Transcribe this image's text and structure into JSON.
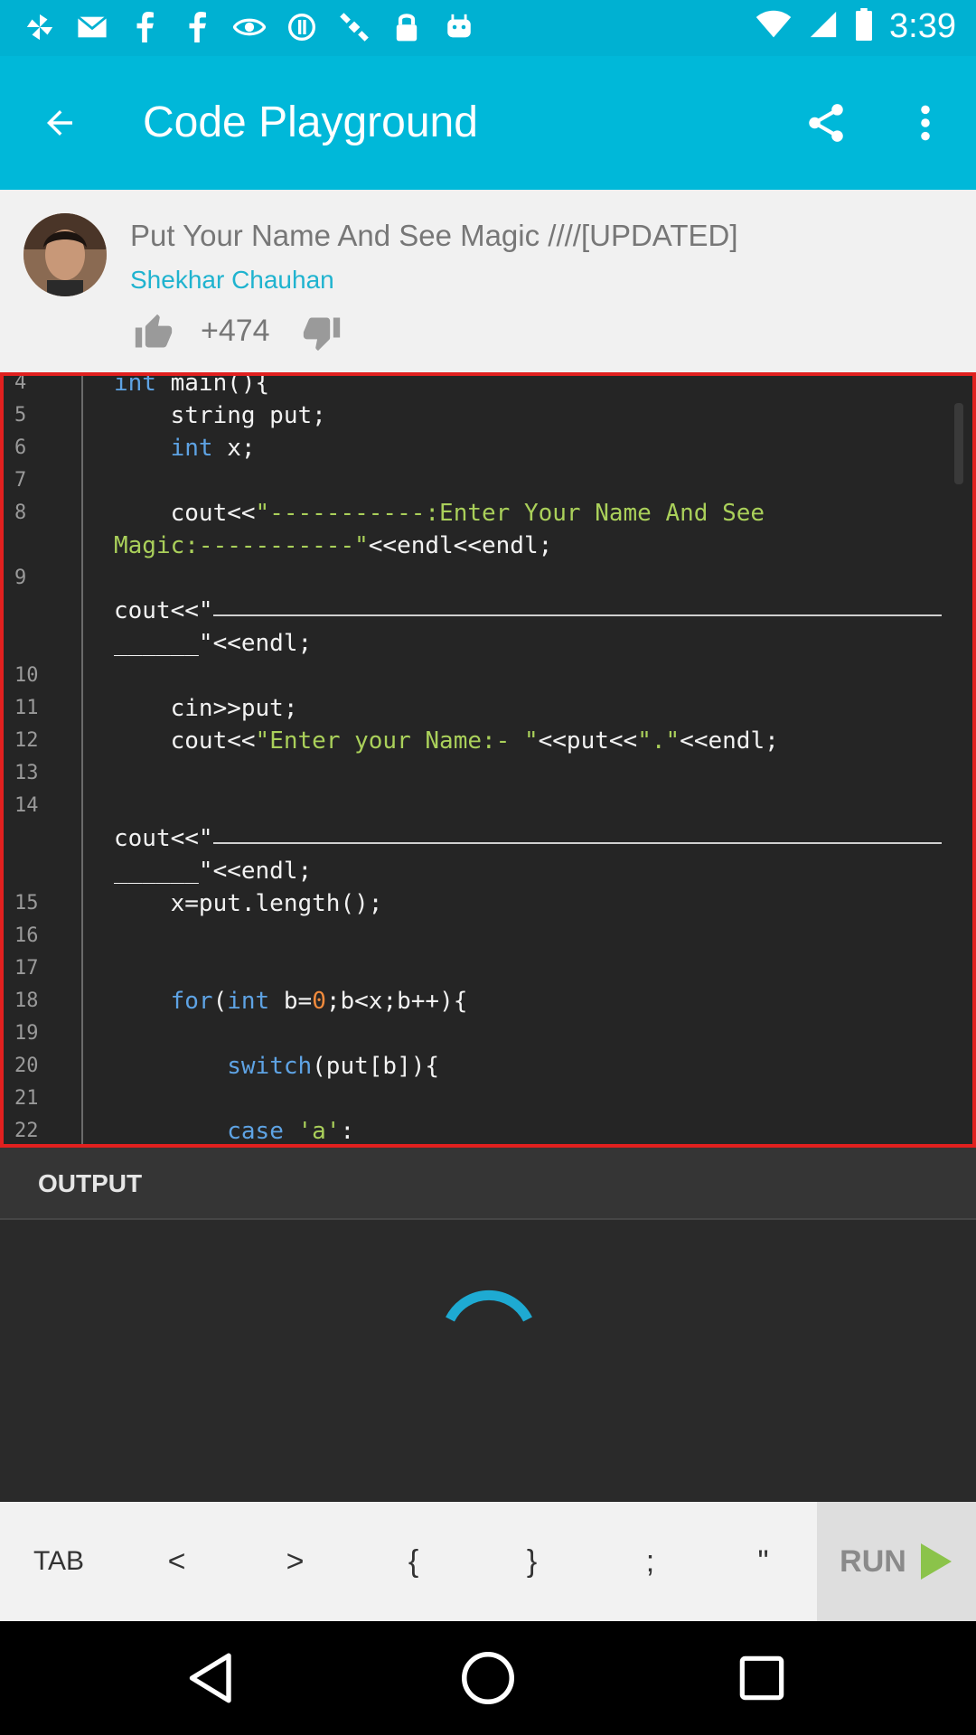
{
  "status_bar": {
    "time": "3:39",
    "icons": [
      "pinwheel-icon",
      "mail-icon",
      "facebook-icon",
      "facebook-icon",
      "eye-icon",
      "circle-info-icon",
      "satellite-icon",
      "lock-icon",
      "android-icon"
    ]
  },
  "app_bar": {
    "title": "Code Playground",
    "color": "#00b8d9"
  },
  "post": {
    "title": "Put Your Name And See Magic ////[UPDATED]",
    "author": "Shekhar Chauhan",
    "votes": "+474"
  },
  "code": [
    {
      "ln": "4",
      "text": "int main(){"
    },
    {
      "ln": "5",
      "text": "    string put;"
    },
    {
      "ln": "6",
      "text": "    int x;"
    },
    {
      "ln": "7",
      "text": ""
    },
    {
      "ln": "8",
      "text": "    cout<<\"-----------:Enter Your Name And See"
    },
    {
      "ln": "",
      "text": "Magic:-----------\"<<endl<<endl;"
    },
    {
      "ln": "9",
      "text": ""
    },
    {
      "ln": "",
      "text": "cout<<\""
    },
    {
      "ln": "",
      "text": "______\"<<endl;"
    },
    {
      "ln": "10",
      "text": ""
    },
    {
      "ln": "11",
      "text": "    cin>>put;"
    },
    {
      "ln": "12",
      "text": "    cout<<\"Enter your Name:- \"<<put<<\".\"<<endl;"
    },
    {
      "ln": "13",
      "text": ""
    },
    {
      "ln": "14",
      "text": ""
    },
    {
      "ln": "",
      "text": "cout<<\""
    },
    {
      "ln": "",
      "text": "______\"<<endl;"
    },
    {
      "ln": "15",
      "text": "    x=put.length();"
    },
    {
      "ln": "16",
      "text": ""
    },
    {
      "ln": "17",
      "text": ""
    },
    {
      "ln": "18",
      "text": "    for(int b=0;b<x;b++){"
    },
    {
      "ln": "19",
      "text": ""
    },
    {
      "ln": "20",
      "text": "        switch(put[b]){"
    },
    {
      "ln": "21",
      "text": ""
    },
    {
      "ln": "22",
      "text": "        case 'a':"
    }
  ],
  "output": {
    "label": "OUTPUT"
  },
  "keys": [
    "TAB",
    "<",
    ">",
    "{",
    "}",
    ";",
    "\""
  ],
  "run_label": "RUN",
  "colors": {
    "accent": "#00b8d9",
    "editor_border": "#e1201f",
    "run_arrow": "#8bc34a",
    "keyword": "#5ea3e4",
    "string": "#aad05a",
    "number": "#f08a3c"
  }
}
